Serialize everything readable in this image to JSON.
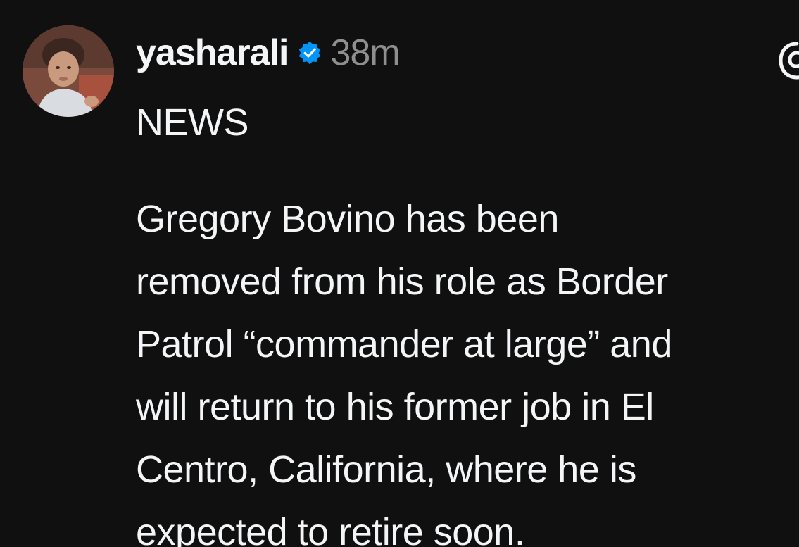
{
  "post": {
    "username": "yasharali",
    "timestamp": "38m",
    "verified": true,
    "accent_color": "#0095f6",
    "avatar_icon": "user-avatar-photo",
    "headline": "NEWS",
    "body_lines": [
      "Gregory Bovino has been",
      "removed from his role as Border",
      "Patrol “commander at large” and",
      "will return to his former job in El",
      "Centro, California, where he is",
      "expected to retire soon."
    ]
  }
}
